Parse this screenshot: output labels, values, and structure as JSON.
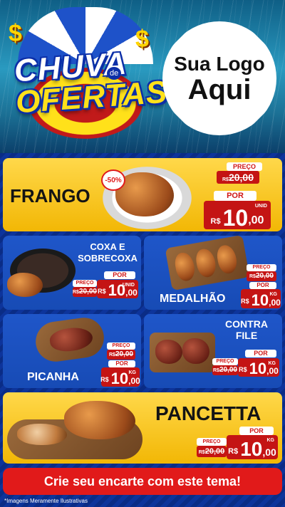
{
  "header": {
    "title_line1": "CHUVA",
    "title_de": "de",
    "title_line2": "OFERTAS",
    "logo_line1": "Sua Logo",
    "logo_line2": "Aqui"
  },
  "products": [
    {
      "name": "FRANGO",
      "discount": "-50%",
      "price_label": "PREÇO",
      "old_currency": "R$",
      "old_value": "20,00",
      "por_label": "POR",
      "new_currency": "R$",
      "new_int": "10",
      "new_dec": ",00",
      "unit": "UNID"
    },
    {
      "name_line1": "COXA E",
      "name_line2": "SOBRECOXA",
      "price_label": "POR",
      "old_label": "PREÇO",
      "old_currency": "R$",
      "old_value": "20,00",
      "new_currency": "R$",
      "new_int": "10",
      "new_dec": ",00",
      "unit": "UNID"
    },
    {
      "name": "MEDALHÃO",
      "old_label": "PREÇO",
      "old_currency": "R$",
      "old_value": "20,00",
      "por_label": "POR",
      "new_currency": "R$",
      "new_int": "10",
      "new_dec": ",00",
      "unit": "KG"
    },
    {
      "name": "PICANHA",
      "old_label": "PREÇO",
      "old_currency": "R$",
      "old_value": "20,00",
      "por_label": "POR",
      "new_currency": "R$",
      "new_int": "10",
      "new_dec": ",00",
      "unit": "KG"
    },
    {
      "name_line1": "CONTRA",
      "name_line2": "FILE",
      "old_label": "PREÇO",
      "old_currency": "R$",
      "old_value": "20,00",
      "por_label": "POR",
      "new_currency": "R$",
      "new_int": "10",
      "new_dec": ",00",
      "unit": "KG"
    },
    {
      "name": "PANCETTA",
      "old_label": "PREÇO",
      "old_currency": "R$",
      "old_value": "20,00",
      "por_label": "POR",
      "new_currency": "R$",
      "new_int": "10",
      "new_dec": ",00",
      "unit": "KG"
    }
  ],
  "cta": "Crie seu encarte com este tema!",
  "footnote": "*Imagens Meramente Ilustrativas",
  "colors": {
    "gold": "#f2b705",
    "blue_panel": "#1f56c9",
    "red_price": "#c41414",
    "background": "#0b2f8f"
  },
  "icons": [
    "dollar-sign-icon",
    "umbrella-icon"
  ]
}
